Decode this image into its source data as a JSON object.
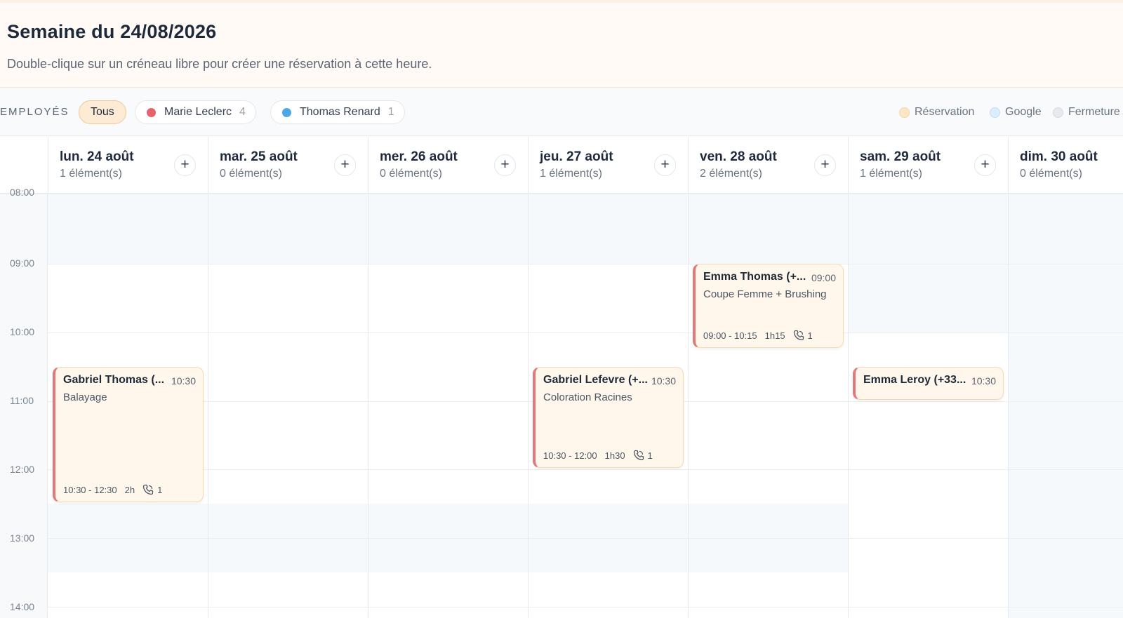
{
  "header": {
    "title": "Semaine du 24/08/2026",
    "subtitle": "Double-clique sur un créneau libre pour créer une réservation à cette heure."
  },
  "filters": {
    "label": "EMPLOYÉS",
    "all_label": "Tous",
    "employees": [
      {
        "name": "Marie Leclerc",
        "count": "4",
        "color": "#e5636b"
      },
      {
        "name": "Thomas Renard",
        "count": "1",
        "color": "#4ea8e8"
      }
    ]
  },
  "legend": [
    {
      "label": "Réservation",
      "color": "#fde6c6"
    },
    {
      "label": "Google",
      "color": "#dbeefe"
    },
    {
      "label": "Fermeture",
      "color": "#e6eaef"
    }
  ],
  "add_icon": "+",
  "days": [
    {
      "name": "lun. 24 août",
      "count": "1 élément(s)"
    },
    {
      "name": "mar. 25 août",
      "count": "0 élément(s)"
    },
    {
      "name": "mer. 26 août",
      "count": "0 élément(s)"
    },
    {
      "name": "jeu. 27 août",
      "count": "1 élément(s)"
    },
    {
      "name": "ven. 28 août",
      "count": "2 élément(s)"
    },
    {
      "name": "sam. 29 août",
      "count": "1 élément(s)"
    },
    {
      "name": "dim. 30 août",
      "count": "0 élément(s)"
    }
  ],
  "hours": [
    "08:00",
    "09:00",
    "10:00",
    "11:00",
    "12:00",
    "13:00",
    "14:00"
  ],
  "events": [
    {
      "name": "Gabriel Thomas (...",
      "time": "10:30",
      "service": "Balayage",
      "range": "10:30 - 12:30",
      "duration": "2h",
      "count": "1"
    },
    {
      "name": "Gabriel Lefevre (+...",
      "time": "10:30",
      "service": "Coloration Racines",
      "range": "10:30 - 12:00",
      "duration": "1h30",
      "count": "1"
    },
    {
      "name": "Emma Thomas (+...",
      "time": "09:00",
      "service": "Coupe Femme + Brushing",
      "range": "09:00 - 10:15",
      "duration": "1h15",
      "count": "1"
    },
    {
      "name": "Emma Leroy (+33...",
      "time": "10:30"
    }
  ]
}
